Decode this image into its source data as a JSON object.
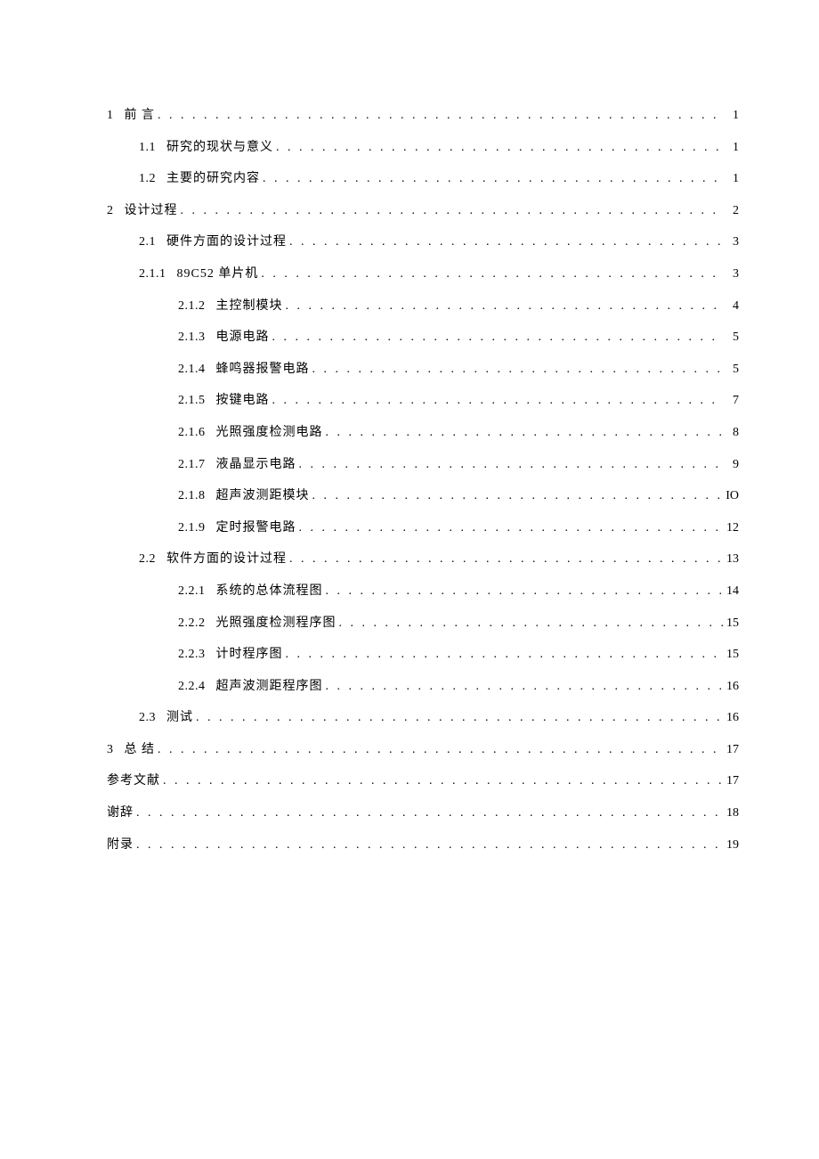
{
  "toc": [
    {
      "indent": 0,
      "num": "1",
      "title": "前 言",
      "page": "1"
    },
    {
      "indent": 1,
      "num": "1.1",
      "title": "研究的现状与意义",
      "page": "1"
    },
    {
      "indent": 1,
      "num": "1.2",
      "title": "主要的研究内容",
      "page": "1"
    },
    {
      "indent": 0,
      "num": "2",
      "title": "设计过程",
      "page": "2"
    },
    {
      "indent": 1,
      "num": "2.1",
      "title": "硬件方面的设计过程",
      "page": "3"
    },
    {
      "indent": 2,
      "num": "2.1.1",
      "title": "89C52 单片机",
      "page": "3"
    },
    {
      "indent": 3,
      "num": "2.1.2",
      "title": "主控制模块",
      "page": "4"
    },
    {
      "indent": 3,
      "num": "2.1.3",
      "title": "电源电路",
      "page": "5"
    },
    {
      "indent": 3,
      "num": "2.1.4",
      "title": "蜂鸣器报警电路",
      "page": "5"
    },
    {
      "indent": 3,
      "num": "2.1.5",
      "title": "按键电路",
      "page": "7"
    },
    {
      "indent": 3,
      "num": "2.1.6",
      "title": "光照强度检测电路",
      "page": "8"
    },
    {
      "indent": 3,
      "num": "2.1.7",
      "title": "液晶显示电路",
      "page": "9"
    },
    {
      "indent": 3,
      "num": "2.1.8",
      "title": "超声波测距模块",
      "page": "IO"
    },
    {
      "indent": 3,
      "num": "2.1.9",
      "title": "定时报警电路",
      "page": "12"
    },
    {
      "indent": 1,
      "num": "2.2",
      "title": "软件方面的设计过程",
      "page": "13"
    },
    {
      "indent": 3,
      "num": "2.2.1",
      "title": "系统的总体流程图",
      "page": "14"
    },
    {
      "indent": 3,
      "num": "2.2.2",
      "title": "光照强度检测程序图",
      "page": "15"
    },
    {
      "indent": 3,
      "num": "2.2.3",
      "title": "计时程序图",
      "page": "15"
    },
    {
      "indent": 3,
      "num": "2.2.4",
      "title": "超声波测距程序图",
      "page": "16"
    },
    {
      "indent": 1,
      "num": "2.3",
      "title": "测试",
      "page": "16"
    },
    {
      "indent": 0,
      "num": "3",
      "title": "总 结",
      "page": "17"
    },
    {
      "indent": 0,
      "num": "",
      "title": "参考文献",
      "page": "17"
    },
    {
      "indent": 0,
      "num": "",
      "title": "谢辞",
      "page": "18"
    },
    {
      "indent": 0,
      "num": "",
      "title": "附录",
      "page": "19"
    }
  ]
}
